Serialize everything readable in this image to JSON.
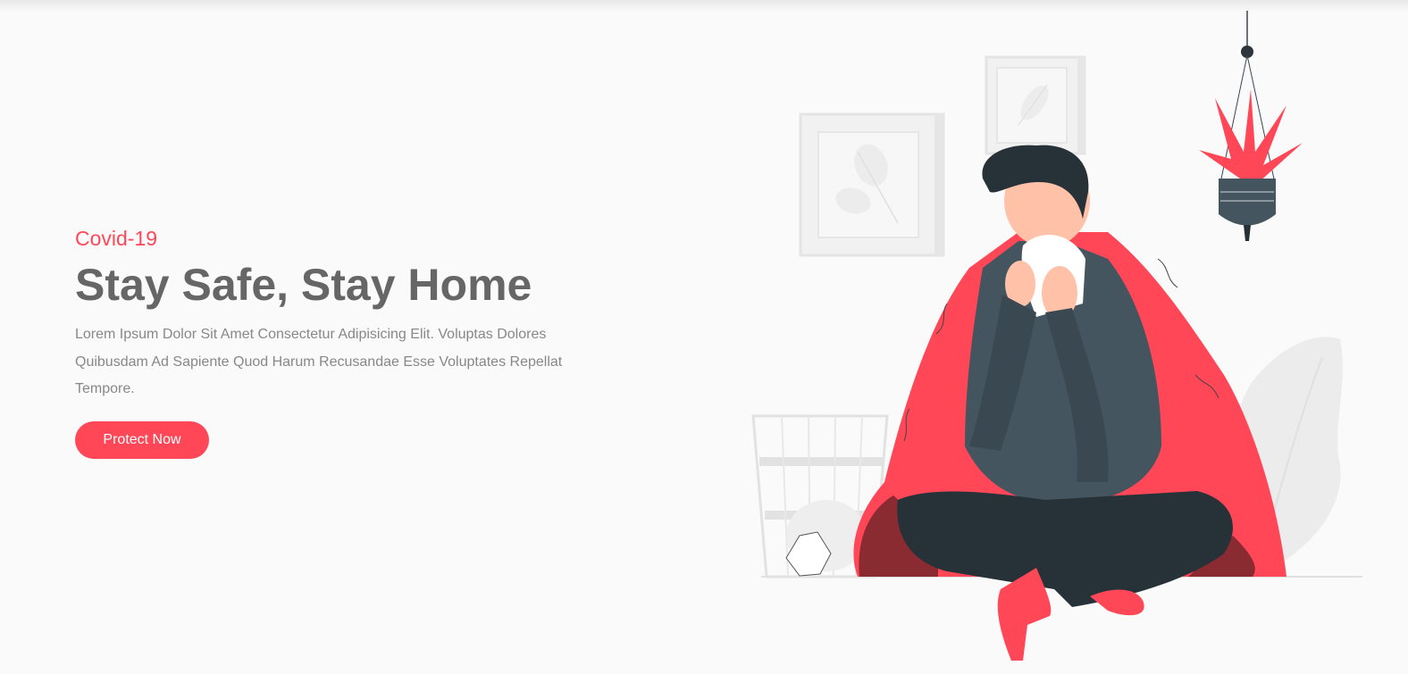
{
  "hero": {
    "eyebrow": "Covid-19",
    "title": "Stay Safe, Stay Home",
    "description": "Lorem Ipsum Dolor Sit Amet Consectetur Adipisicing Elit. Voluptas Dolores Quibusdam Ad Sapiente Quod Harum Recusandae Esse Voluptates Repellat Tempore.",
    "cta_label": "Protect Now"
  },
  "colors": {
    "accent": "#ff4757",
    "heading": "#666666",
    "body_text": "#888888",
    "background": "#fafafa"
  },
  "illustration": {
    "icon": "sick-person-sneezing-illustration"
  }
}
